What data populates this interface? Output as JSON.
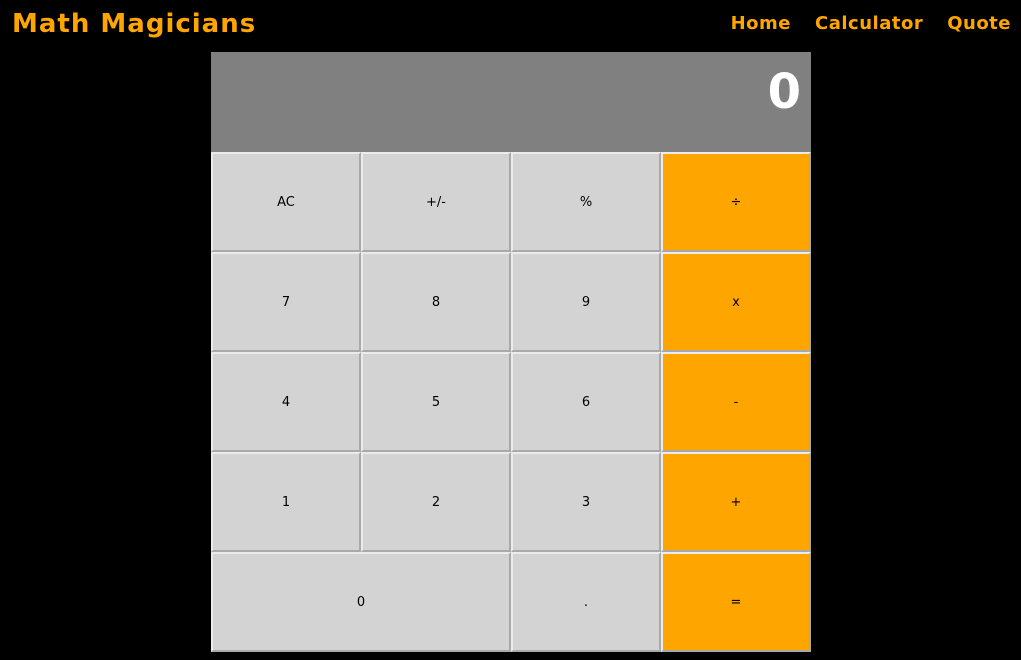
{
  "header": {
    "brand": "Math Magicians",
    "nav": [
      {
        "label": "Home"
      },
      {
        "label": "Calculator"
      },
      {
        "label": "Quote"
      }
    ]
  },
  "calculator": {
    "display": "0",
    "keys": {
      "ac": "AC",
      "plus_minus": "+/-",
      "percent": "%",
      "divide": "÷",
      "seven": "7",
      "eight": "8",
      "nine": "9",
      "multiply": "x",
      "four": "4",
      "five": "5",
      "six": "6",
      "minus": "-",
      "one": "1",
      "two": "2",
      "three": "3",
      "plus": "+",
      "zero": "0",
      "decimal": ".",
      "equals": "="
    }
  },
  "colors": {
    "accent": "#FFA500",
    "background": "#000000",
    "display_bg": "#808080",
    "key_bg": "#D3D3D3"
  }
}
